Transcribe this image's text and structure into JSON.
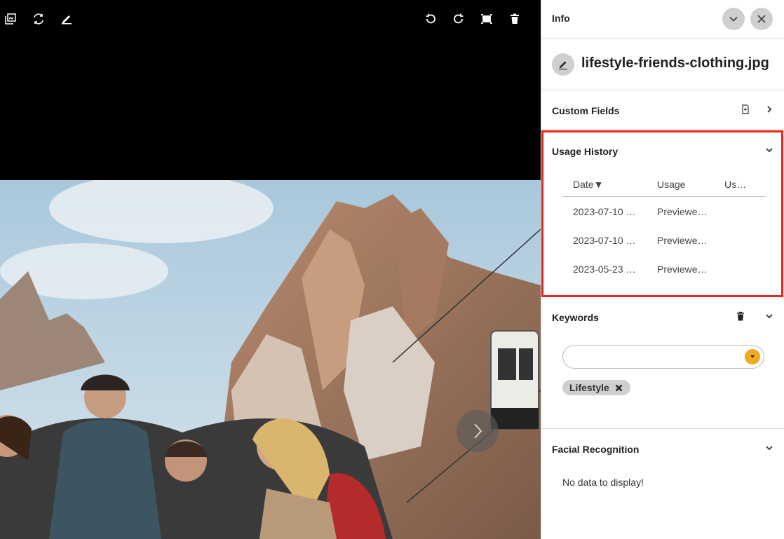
{
  "viewer": {
    "toolbar_left": [
      "gallery-icon",
      "swap-icon",
      "edit-icon"
    ],
    "toolbar_right": [
      "rotate-left-icon",
      "rotate-right-icon",
      "crop-icon",
      "trash-icon"
    ]
  },
  "panel": {
    "title": "Info",
    "file_name": "lifestyle-friends-clothing.jpg",
    "custom_fields": {
      "title": "Custom Fields"
    },
    "usage_history": {
      "title": "Usage History",
      "columns": [
        "Date▼",
        "Usage",
        "Us…"
      ],
      "rows": [
        [
          "2023-07-10 …",
          "Previewe…",
          ""
        ],
        [
          "2023-07-10 …",
          "Previewe…",
          ""
        ],
        [
          "2023-05-23 …",
          "Previewe…",
          ""
        ]
      ]
    },
    "keywords": {
      "title": "Keywords",
      "input_value": "",
      "chips": [
        "Lifestyle"
      ]
    },
    "facial_recognition": {
      "title": "Facial Recognition",
      "empty_text": "No data to display!"
    }
  },
  "colors": {
    "highlight": "#e8261a",
    "accent": "#f0aa1e",
    "button_bg": "#cfcfcf"
  }
}
